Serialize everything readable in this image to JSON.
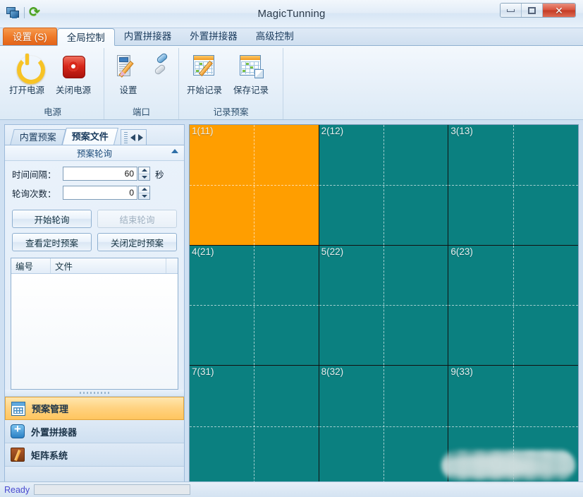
{
  "window": {
    "title": "MagicTunning",
    "icons": [
      "monitor-icon",
      "refresh-icon"
    ],
    "controls": {
      "minimize": "–",
      "maximize": "□",
      "close": "✕"
    }
  },
  "ribbon": {
    "tabs": [
      {
        "label": "设置 (S)",
        "kind": "file"
      },
      {
        "label": "全局控制",
        "kind": "active"
      },
      {
        "label": "内置拼接器",
        "kind": "normal"
      },
      {
        "label": "外置拼接器",
        "kind": "normal"
      },
      {
        "label": "高级控制",
        "kind": "normal"
      }
    ],
    "groups": [
      {
        "label": "电源",
        "buttons": [
          {
            "label": "打开电源",
            "icon": "power-on-icon"
          },
          {
            "label": "关闭电源",
            "icon": "power-off-icon"
          }
        ]
      },
      {
        "label": "端口",
        "buttons": [
          {
            "label": "设置",
            "icon": "settings-icon"
          },
          {
            "label": "",
            "icon": "port-plug-icon"
          }
        ]
      },
      {
        "label": "记录预案",
        "buttons": [
          {
            "label": "开始记录",
            "icon": "record-start-icon"
          },
          {
            "label": "保存记录",
            "icon": "record-save-icon"
          }
        ]
      }
    ]
  },
  "left_panel": {
    "tabs": [
      {
        "label": "内置预案",
        "selected": false
      },
      {
        "label": "预案文件",
        "selected": true
      }
    ],
    "tab_nav": {
      "prev": "◀",
      "next": "▶"
    },
    "group": {
      "title": "预案轮询",
      "collapse_icon": "chevron-up-icon"
    },
    "fields": [
      {
        "label": "时间间隔：",
        "value": "60",
        "unit": "秒"
      },
      {
        "label": "轮询次数：",
        "value": "0",
        "unit": ""
      }
    ],
    "buttons": [
      {
        "label": "开始轮询",
        "disabled": false
      },
      {
        "label": "结束轮询",
        "disabled": true
      },
      {
        "label": "查看定时预案",
        "disabled": false
      },
      {
        "label": "关闭定时预案",
        "disabled": false
      }
    ],
    "list": {
      "columns": [
        "编号",
        "文件"
      ],
      "rows": []
    },
    "nav_items": [
      {
        "label": "预案管理",
        "icon": "calendar-icon",
        "selected": true
      },
      {
        "label": "外置拼接器",
        "icon": "plus-box-icon",
        "selected": false
      },
      {
        "label": "矩阵系统",
        "icon": "notebook-icon",
        "selected": false
      }
    ]
  },
  "wall": {
    "rows": 3,
    "cols": 3,
    "colors": {
      "active": "#FF9E00",
      "idle": "#0B8080"
    },
    "cells": [
      {
        "label": "1(11)",
        "state": "active"
      },
      {
        "label": "2(12)",
        "state": "idle"
      },
      {
        "label": "3(13)",
        "state": "idle"
      },
      {
        "label": "4(21)",
        "state": "idle"
      },
      {
        "label": "5(22)",
        "state": "idle"
      },
      {
        "label": "6(23)",
        "state": "idle"
      },
      {
        "label": "7(31)",
        "state": "idle"
      },
      {
        "label": "8(32)",
        "state": "idle"
      },
      {
        "label": "9(33)",
        "state": "idle"
      }
    ]
  },
  "status_bar": {
    "text": "Ready"
  }
}
